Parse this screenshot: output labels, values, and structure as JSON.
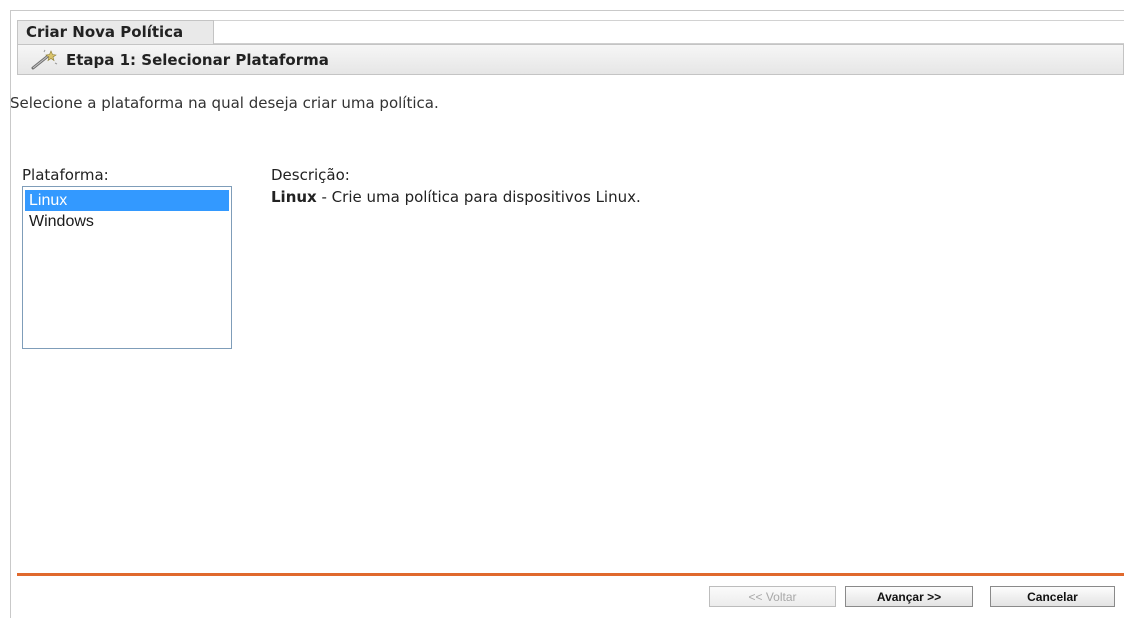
{
  "window": {
    "tab_title": "Criar Nova Política"
  },
  "step": {
    "title": "Etapa 1: Selecionar Plataforma",
    "icon": "wand-icon"
  },
  "instruction": "Selecione a plataforma na qual deseja criar uma política.",
  "platform": {
    "label": "Plataforma:",
    "options": [
      "Linux",
      "Windows"
    ],
    "selected": "Linux"
  },
  "description": {
    "label": "Descrição:",
    "name": "Linux",
    "text": " - Crie uma política para dispositivos Linux."
  },
  "buttons": {
    "back": "<< Voltar",
    "next": "Avançar >>",
    "cancel": "Cancelar"
  },
  "colors": {
    "accent_rule": "#e0692d",
    "selection": "#3399ff"
  }
}
